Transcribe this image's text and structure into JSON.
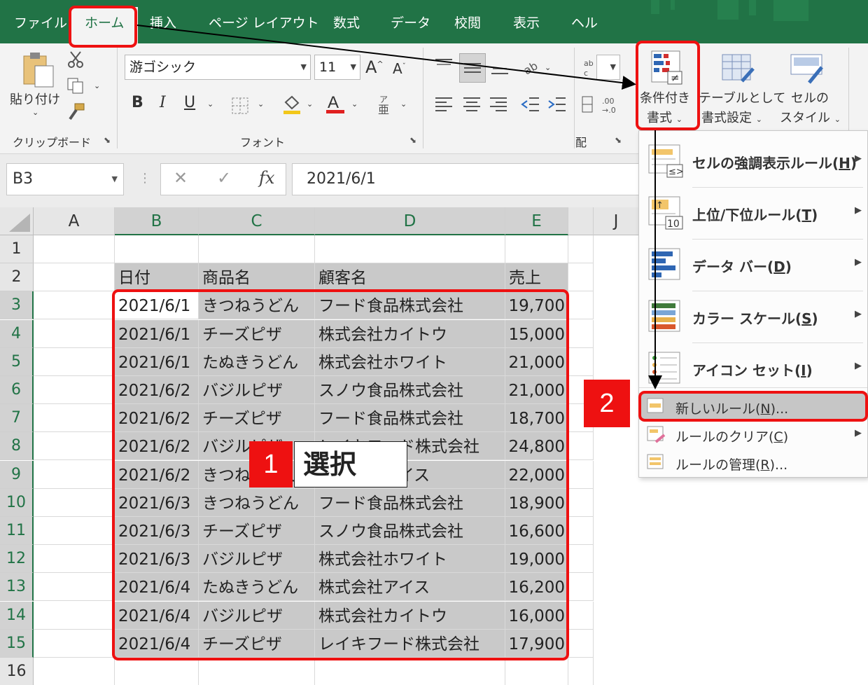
{
  "tabs": [
    "ファイル",
    "ホーム",
    "挿入",
    "ページ レイアウト",
    "数式",
    "データ",
    "校閲",
    "表示",
    "ヘル"
  ],
  "ribbon": {
    "clipboard": {
      "paste": "貼り付け",
      "group": "クリップボード"
    },
    "font": {
      "name": "游ゴシック",
      "size": "11",
      "bold": "B",
      "italic": "I",
      "underline": "U",
      "group": "フォント"
    },
    "alignment": {
      "group": "配"
    },
    "styles": {
      "cond_format_l1": "条件付き",
      "cond_format_l2": "書式",
      "table_l1": "テーブルとして",
      "table_l2": "書式設定",
      "cell_l1": "セルの",
      "cell_l2": "スタイル"
    }
  },
  "formula_bar": {
    "name_box": "B3",
    "formula": "2021/6/1",
    "fx": "fx"
  },
  "sheet": {
    "columns": [
      "A",
      "B",
      "C",
      "D",
      "E",
      "J"
    ],
    "rows": [
      "1",
      "2",
      "3",
      "4",
      "5",
      "6",
      "7",
      "8",
      "9",
      "10",
      "11",
      "12",
      "13",
      "14",
      "15",
      "16"
    ],
    "headers": [
      "日付",
      "商品名",
      "顧客名",
      "売上"
    ],
    "data": [
      [
        "2021/6/1",
        "きつねうどん",
        "フード食品株式会社",
        "19,700"
      ],
      [
        "2021/6/1",
        "チーズピザ",
        "株式会社カイトウ",
        "15,000"
      ],
      [
        "2021/6/1",
        "たぬきうどん",
        "株式会社ホワイト",
        "21,000"
      ],
      [
        "2021/6/2",
        "バジルピザ",
        "スノウ食品株式会社",
        "21,000"
      ],
      [
        "2021/6/2",
        "チーズピザ",
        "フード食品株式会社",
        "18,700"
      ],
      [
        "2021/6/2",
        "バジルピザ",
        "レイキフード株式会社",
        "24,800"
      ],
      [
        "2021/6/2",
        "きつねうどん",
        "株式会社アイス",
        "22,000"
      ],
      [
        "2021/6/3",
        "きつねうどん",
        "フード食品株式会社",
        "18,900"
      ],
      [
        "2021/6/3",
        "チーズピザ",
        "スノウ食品株式会社",
        "16,600"
      ],
      [
        "2021/6/3",
        "バジルピザ",
        "株式会社ホワイト",
        "19,000"
      ],
      [
        "2021/6/4",
        "たぬきうどん",
        "株式会社アイス",
        "16,200"
      ],
      [
        "2021/6/4",
        "バジルピザ",
        "株式会社カイトウ",
        "16,000"
      ],
      [
        "2021/6/4",
        "チーズピザ",
        "レイキフード株式会社",
        "17,900"
      ]
    ]
  },
  "cf_menu": [
    {
      "label": "セルの強調表示ルール(",
      "key": "H",
      "end": ")",
      "submenu": true
    },
    {
      "label": "上位/下位ルール(",
      "key": "T",
      "end": ")",
      "submenu": true
    },
    {
      "label": "データ バー(",
      "key": "D",
      "end": ")",
      "submenu": true
    },
    {
      "label": "カラー スケール(",
      "key": "S",
      "end": ")",
      "submenu": true
    },
    {
      "label": "アイコン セット(",
      "key": "I",
      "end": ")",
      "submenu": true
    },
    {
      "label": "新しいルール(",
      "key": "N",
      "end": ")...",
      "submenu": false
    },
    {
      "label": "ルールのクリア(",
      "key": "C",
      "end": ")",
      "submenu": true
    },
    {
      "label": "ルールの管理(",
      "key": "R",
      "end": ")...",
      "submenu": false
    }
  ],
  "annotations": {
    "step1_num": "1",
    "step1_text": "選択",
    "step2_num": "2"
  },
  "colors": {
    "excel_green": "#217346",
    "highlight_red": "#ee1111",
    "selection_gray": "#c9c9c9"
  }
}
